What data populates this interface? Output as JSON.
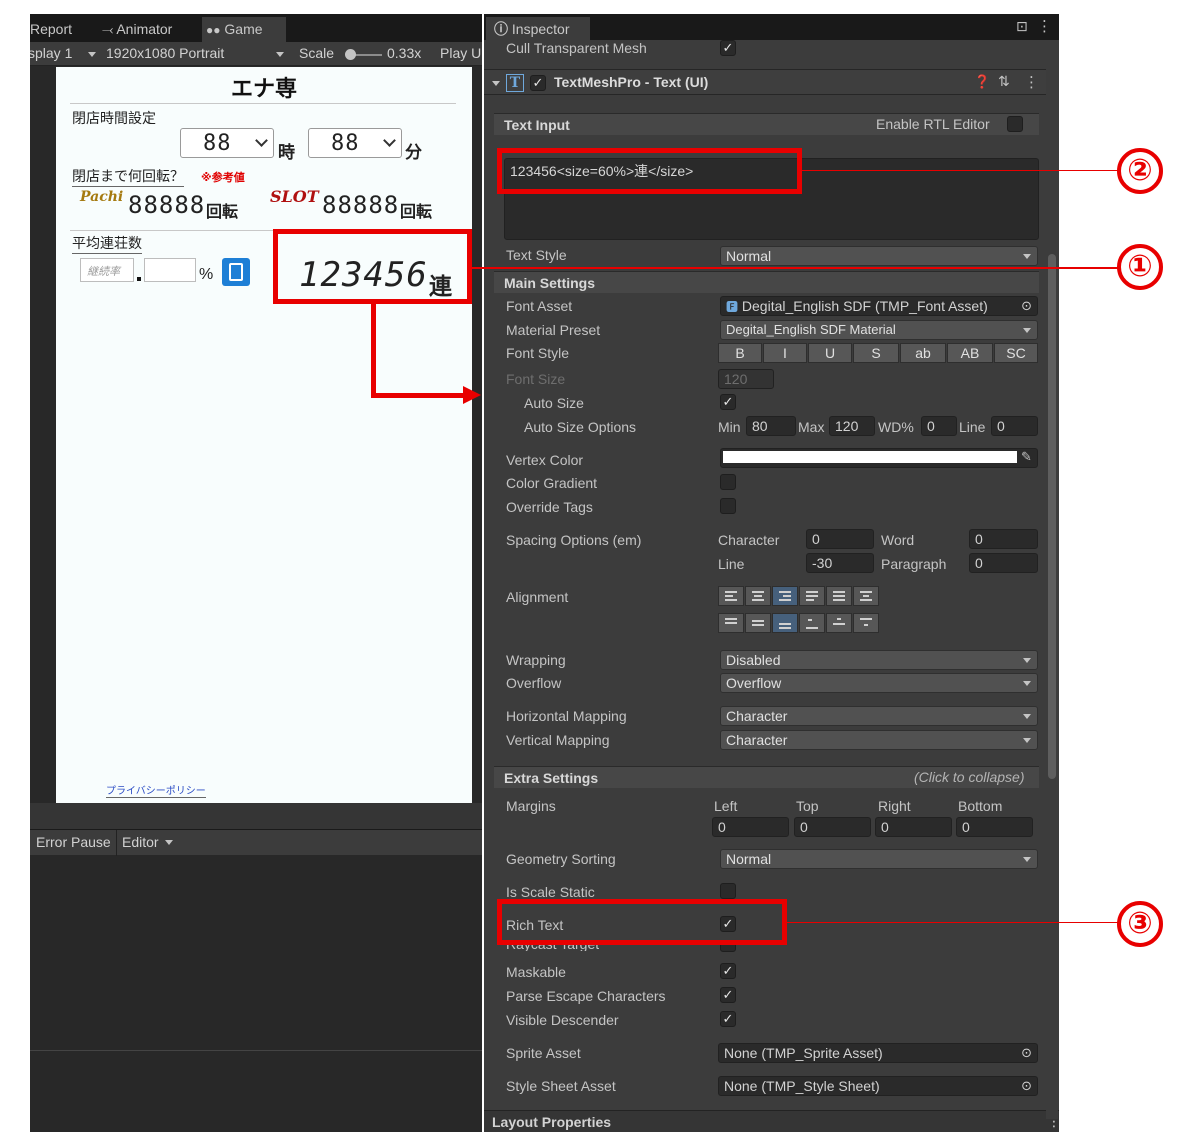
{
  "game_view": {
    "tabs": [
      "Report",
      "Animator",
      "Game"
    ],
    "toolbar": {
      "display": "splay 1",
      "resolution": "1920x1080 Portrait",
      "scale_label": "Scale",
      "scale_value": "0.33x",
      "play": "Play U"
    },
    "app": {
      "title": "エナ専",
      "closing_time_label": "閉店時間設定",
      "hour_value": "88",
      "hour_unit": "時",
      "minute_value": "88",
      "minute_unit": "分",
      "spins_label": "閉店まで何回転？",
      "reference_note": "※参考値",
      "pachi_logo": "Pachi",
      "pachi_value": "88888",
      "pachi_unit": "回転",
      "slot_logo": "SLOT",
      "slot_value": "88888",
      "slot_unit": "回転",
      "avg_label": "平均連荘数",
      "rate_placeholder": "継続率",
      "percent": "%",
      "big_value": "123456",
      "big_unit": "連",
      "privacy_link": "プライバシーポリシー"
    },
    "console": {
      "error_pause": "Error Pause",
      "editor": "Editor"
    }
  },
  "inspector": {
    "tab": "Inspector",
    "cull_label": "Cull Transparent Mesh",
    "component_title": "TextMeshPro - Text (UI)",
    "text_input_header": "Text Input",
    "rtl_label": "Enable RTL Editor",
    "text_value": "123456<size=60%>連</size>",
    "text_style_label": "Text Style",
    "text_style_value": "Normal",
    "main_settings": "Main Settings",
    "font_asset_label": "Font Asset",
    "font_asset_value": "Degital_English SDF (TMP_Font Asset)",
    "material_preset_label": "Material Preset",
    "material_preset_value": "Degital_English SDF Material",
    "font_style_label": "Font Style",
    "font_style_buttons": [
      "B",
      "I",
      "U",
      "S",
      "ab",
      "AB",
      "SC"
    ],
    "font_size_label": "Font Size",
    "font_size_value": "120",
    "auto_size_label": "Auto Size",
    "auto_size_options_label": "Auto Size Options",
    "auto_size": {
      "min_label": "Min",
      "min": "80",
      "max_label": "Max",
      "max": "120",
      "wd_label": "WD%",
      "wd": "0",
      "line_label": "Line",
      "line": "0"
    },
    "vertex_color_label": "Vertex Color",
    "color_gradient_label": "Color Gradient",
    "override_tags_label": "Override Tags",
    "spacing_label": "Spacing Options (em)",
    "spacing": {
      "character_label": "Character",
      "character": "0",
      "word_label": "Word",
      "word": "0",
      "line_label": "Line",
      "line": "-30",
      "paragraph_label": "Paragraph",
      "paragraph": "0"
    },
    "alignment_label": "Alignment",
    "wrapping_label": "Wrapping",
    "wrapping_value": "Disabled",
    "overflow_label": "Overflow",
    "overflow_value": "Overflow",
    "h_mapping_label": "Horizontal Mapping",
    "h_mapping_value": "Character",
    "v_mapping_label": "Vertical Mapping",
    "v_mapping_value": "Character",
    "extra_settings": "Extra Settings",
    "click_to_collapse": "(Click to collapse)",
    "margins_label": "Margins",
    "margins": {
      "left_label": "Left",
      "left": "0",
      "top_label": "Top",
      "top": "0",
      "right_label": "Right",
      "right": "0",
      "bottom_label": "Bottom",
      "bottom": "0"
    },
    "geometry_sorting_label": "Geometry Sorting",
    "geometry_sorting_value": "Normal",
    "is_scale_static_label": "Is Scale Static",
    "rich_text_label": "Rich Text",
    "raycast_target_label": "Raycast Target",
    "maskable_label": "Maskable",
    "parse_escape_label": "Parse Escape Characters",
    "visible_descender_label": "Visible Descender",
    "sprite_asset_label": "Sprite Asset",
    "sprite_asset_value": "None (TMP_Sprite Asset)",
    "style_sheet_label": "Style Sheet Asset",
    "style_sheet_value": "None (TMP_Style Sheet)",
    "layout_properties": "Layout Properties",
    "check_mark": "✓"
  },
  "annotations": {
    "one": "①",
    "two": "②",
    "three": "③"
  }
}
